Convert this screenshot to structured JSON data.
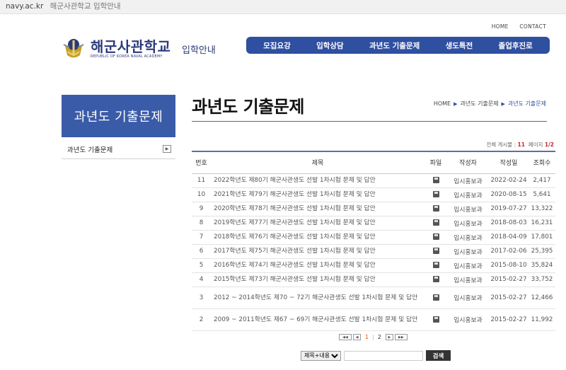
{
  "browser": {
    "domain": "navy.ac.kr",
    "page_title": "해군사관학교 입학안내"
  },
  "top_links": [
    "HOME",
    "CONTACT"
  ],
  "logo": {
    "main": "해군사관학교",
    "sub": "REPUBLIC OF KOREA NAVAL ACADEMY",
    "admission": "입학안내"
  },
  "gnb": [
    "모집요강",
    "입학상담",
    "과년도 기출문제",
    "생도특전",
    "졸업후진로"
  ],
  "lnb": {
    "title": "과년도 기출문제",
    "items": [
      {
        "label": "과년도 기출문제"
      }
    ]
  },
  "content": {
    "title": "과년도 기출문제",
    "breadcrumb": [
      "HOME",
      "과년도 기출문제",
      "과년도 기출문제"
    ],
    "total": {
      "label": "전체 게시물 :",
      "count": "11",
      "page_label": "페이지",
      "page": "1/2"
    }
  },
  "board": {
    "headers": [
      "번호",
      "제목",
      "파일",
      "작성자",
      "작성일",
      "조회수"
    ],
    "rows": [
      {
        "no": "11",
        "subject": "2022학년도 제80기 해군사관생도 선발 1차시험 문제 및 답안",
        "author": "입시홍보과",
        "date": "2022-02-24",
        "views": "2,417"
      },
      {
        "no": "10",
        "subject": "2021학년도 제79기 해군사관생도 선발 1차시험 문제 및 답안",
        "author": "입시홍보과",
        "date": "2020-08-15",
        "views": "5,641"
      },
      {
        "no": "9",
        "subject": "2020학년도 제78기 해군사관생도 선발 1차시험 문제 및 답안",
        "author": "입시홍보과",
        "date": "2019-07-27",
        "views": "13,322"
      },
      {
        "no": "8",
        "subject": "2019학년도 제77기 해군사관생도 선발 1차시험 문제 및 답안",
        "author": "입시홍보과",
        "date": "2018-08-03",
        "views": "16,231"
      },
      {
        "no": "7",
        "subject": "2018학년도 제76기 해군사관생도 선발 1차시험 문제 및 답안",
        "author": "입시홍보과",
        "date": "2018-04-09",
        "views": "17,801"
      },
      {
        "no": "6",
        "subject": "2017학년도 제75기 해군사관생도 선발 1차시험 문제 및 답안",
        "author": "입시홍보과",
        "date": "2017-02-06",
        "views": "25,395"
      },
      {
        "no": "5",
        "subject": "2016학년도 제74기 해군사관생도 선발 1차시험 문제 및 답안",
        "author": "입시홍보과",
        "date": "2015-08-10",
        "views": "35,824"
      },
      {
        "no": "4",
        "subject": "2015학년도 제73기 해군사관생도 선발 1차시험 문제 및 답안",
        "author": "입시홍보과",
        "date": "2015-02-27",
        "views": "33,752"
      },
      {
        "no": "3",
        "subject": "2012 ~ 2014학년도 제70 ~ 72기 해군사관생도 선발 1차시험 문제 및 답안",
        "author": "입시홍보과",
        "date": "2015-02-27",
        "views": "12,466"
      },
      {
        "no": "2",
        "subject": "2009 ~ 2011학년도 제67 ~ 69기 해군사관생도 선발 1차시험 문제 및 답안",
        "author": "입시홍보과",
        "date": "2015-02-27",
        "views": "11,992"
      }
    ]
  },
  "paging": {
    "first": "◀◀",
    "prev": "◀",
    "pages": [
      "1",
      "2"
    ],
    "current": "1",
    "next": "▶",
    "last": "▶▶"
  },
  "search": {
    "select_value": "제목+내용",
    "button": "검색"
  }
}
